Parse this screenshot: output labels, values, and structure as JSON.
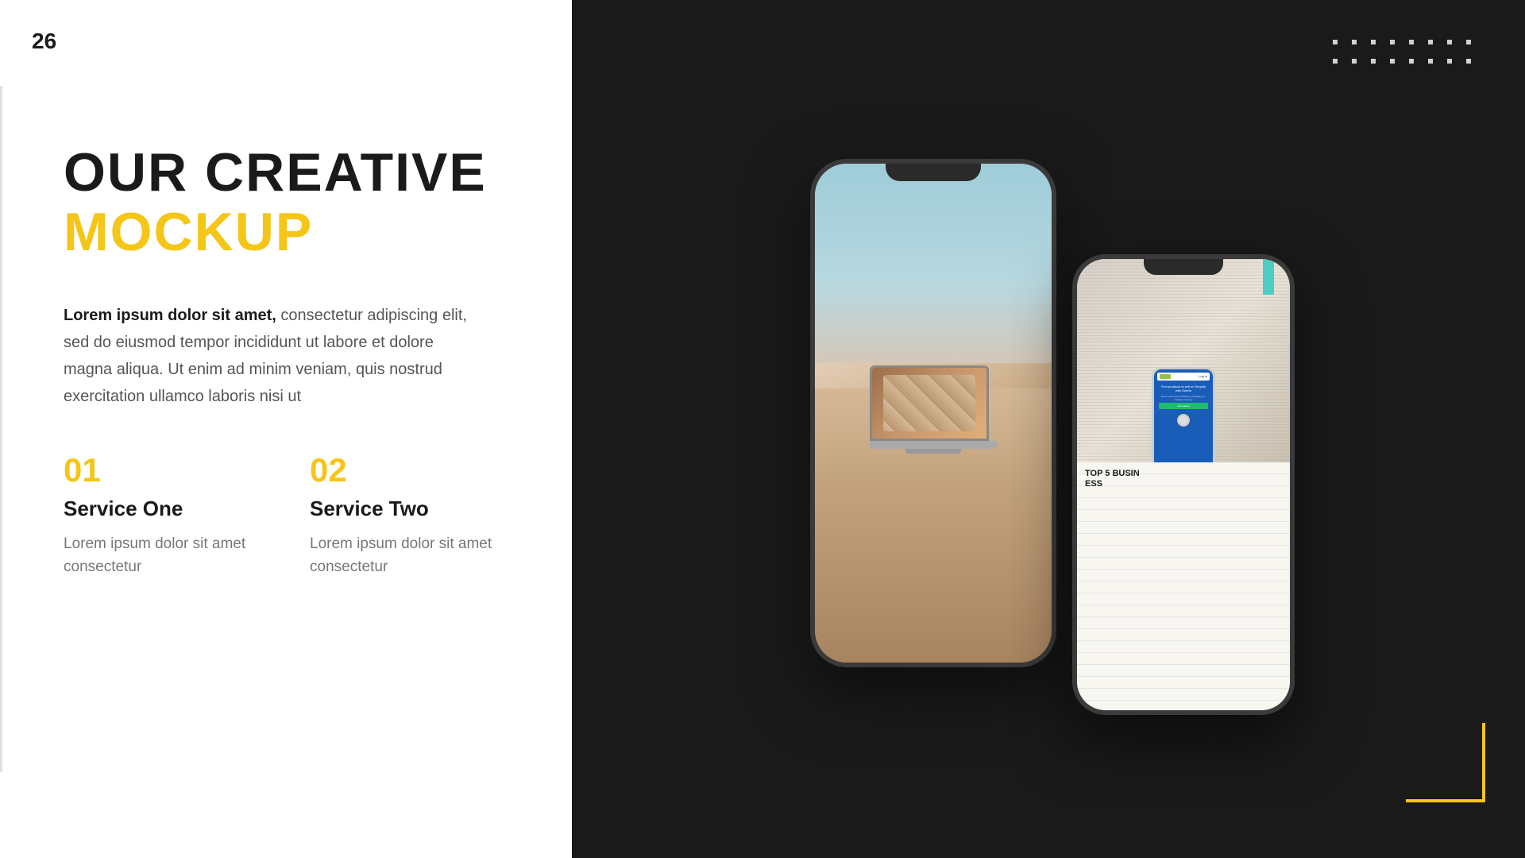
{
  "slide": {
    "page_number": "26",
    "title_line1": "OUR CREATIVE",
    "title_line2": "MOCKUP",
    "description_bold": "Lorem ipsum dolor sit amet,",
    "description_regular": " consectetur adipiscing elit, sed do eiusmod tempor incididunt ut labore et dolore magna aliqua. Ut enim ad minim veniam, quis nostrud exercitation ullamco laboris nisi ut",
    "services": [
      {
        "number": "01",
        "name": "Service One",
        "description": "Lorem ipsum dolor sit amet consectetur"
      },
      {
        "number": "02",
        "name": "Service Two",
        "description": "Lorem ipsum dolor sit amet consectetur"
      }
    ],
    "colors": {
      "accent": "#f5c518",
      "dark": "#1a1a1a",
      "light_text": "#777",
      "right_panel_bg": "#1a1a1a"
    }
  }
}
